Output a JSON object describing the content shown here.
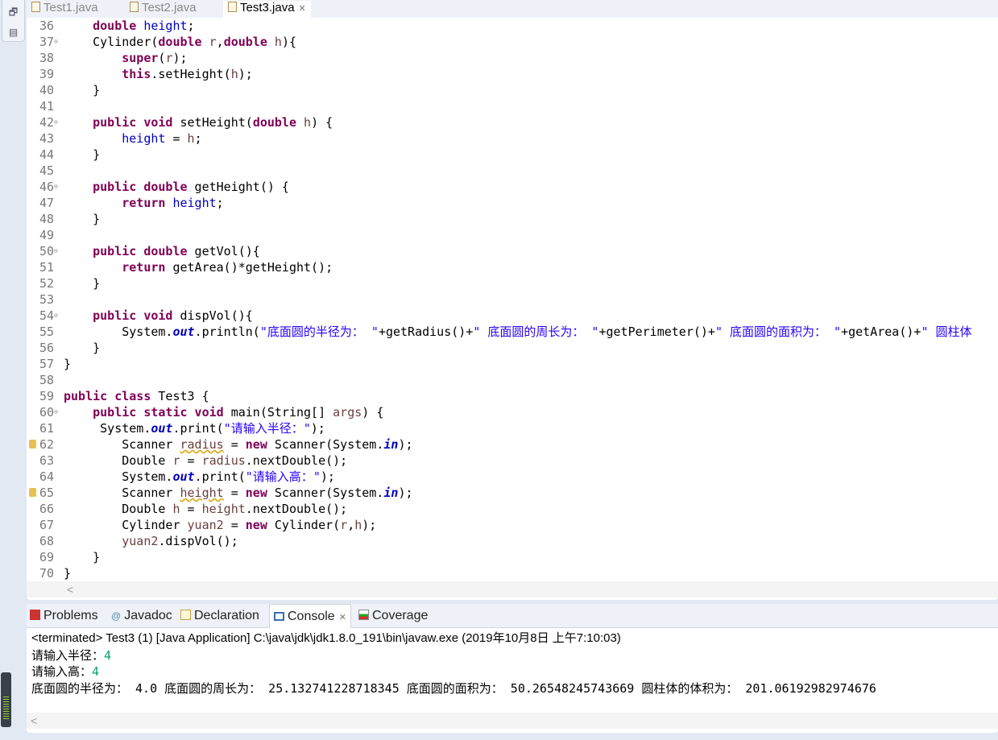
{
  "editor": {
    "tabs": [
      {
        "label": "Test1.java"
      },
      {
        "label": "Test2.java"
      },
      {
        "label": "Test3.java",
        "active": true
      }
    ],
    "close_glyph": "✕",
    "lines": [
      {
        "n": "36",
        "s": [
          [
            "",
            "    "
          ],
          [
            "kw",
            "double"
          ],
          [
            "",
            " "
          ],
          [
            "fld",
            "height"
          ],
          [
            "",
            ";"
          ]
        ]
      },
      {
        "n": "37",
        "fold": true,
        "s": [
          [
            "",
            "    Cylinder("
          ],
          [
            "kw",
            "double"
          ],
          [
            "",
            " "
          ],
          [
            "par",
            "r"
          ],
          [
            "",
            ","
          ],
          [
            "kw",
            "double"
          ],
          [
            "",
            " "
          ],
          [
            "par",
            "h"
          ],
          [
            "",
            "){"
          ]
        ]
      },
      {
        "n": "38",
        "s": [
          [
            "",
            "        "
          ],
          [
            "kw",
            "super"
          ],
          [
            "",
            "("
          ],
          [
            "par",
            "r"
          ],
          [
            "",
            ");"
          ]
        ]
      },
      {
        "n": "39",
        "s": [
          [
            "",
            "        "
          ],
          [
            "kw",
            "this"
          ],
          [
            "",
            ".setHeight("
          ],
          [
            "par",
            "h"
          ],
          [
            "",
            ");"
          ]
        ]
      },
      {
        "n": "40",
        "s": [
          [
            "",
            "    }"
          ]
        ]
      },
      {
        "n": "41",
        "s": []
      },
      {
        "n": "42",
        "fold": true,
        "s": [
          [
            "",
            "    "
          ],
          [
            "kw",
            "public void"
          ],
          [
            "",
            " setHeight("
          ],
          [
            "kw",
            "double"
          ],
          [
            "",
            " "
          ],
          [
            "par",
            "h"
          ],
          [
            "",
            ") {"
          ]
        ]
      },
      {
        "n": "43",
        "s": [
          [
            "",
            "        "
          ],
          [
            "fld",
            "height"
          ],
          [
            "",
            " = "
          ],
          [
            "par",
            "h"
          ],
          [
            "",
            ";"
          ]
        ]
      },
      {
        "n": "44",
        "s": [
          [
            "",
            "    }"
          ]
        ]
      },
      {
        "n": "45",
        "s": []
      },
      {
        "n": "46",
        "fold": true,
        "s": [
          [
            "",
            "    "
          ],
          [
            "kw",
            "public double"
          ],
          [
            "",
            " getHeight() {"
          ]
        ]
      },
      {
        "n": "47",
        "s": [
          [
            "",
            "        "
          ],
          [
            "kw",
            "return"
          ],
          [
            "",
            " "
          ],
          [
            "fld",
            "height"
          ],
          [
            "",
            ";"
          ]
        ]
      },
      {
        "n": "48",
        "s": [
          [
            "",
            "    }"
          ]
        ]
      },
      {
        "n": "49",
        "s": []
      },
      {
        "n": "50",
        "fold": true,
        "s": [
          [
            "",
            "    "
          ],
          [
            "kw",
            "public double"
          ],
          [
            "",
            " getVol(){"
          ]
        ]
      },
      {
        "n": "51",
        "s": [
          [
            "",
            "        "
          ],
          [
            "kw",
            "return"
          ],
          [
            "",
            " getArea()*getHeight();"
          ]
        ]
      },
      {
        "n": "52",
        "s": [
          [
            "",
            "    }"
          ]
        ]
      },
      {
        "n": "53",
        "s": []
      },
      {
        "n": "54",
        "fold": true,
        "s": [
          [
            "",
            "    "
          ],
          [
            "kw",
            "public void"
          ],
          [
            "",
            " dispVol(){"
          ]
        ]
      },
      {
        "n": "55",
        "s": [
          [
            "",
            "        System."
          ],
          [
            "fldi",
            "out"
          ],
          [
            "",
            ".println("
          ],
          [
            "str",
            "\"底面圆的半径为： \""
          ],
          [
            "",
            "+getRadius()+"
          ],
          [
            "str",
            "\" 底面圆的周长为： \""
          ],
          [
            "",
            "+getPerimeter()+"
          ],
          [
            "str",
            "\" 底面圆的面积为： \""
          ],
          [
            "",
            "+getArea()+"
          ],
          [
            "str",
            "\" 圆柱体"
          ]
        ]
      },
      {
        "n": "56",
        "s": [
          [
            "",
            "    }"
          ]
        ]
      },
      {
        "n": "57",
        "s": [
          [
            "",
            "}"
          ]
        ]
      },
      {
        "n": "58",
        "s": []
      },
      {
        "n": "59",
        "s": [
          [
            "kw",
            "public class"
          ],
          [
            "",
            " Test3 {"
          ]
        ]
      },
      {
        "n": "60",
        "fold": true,
        "s": [
          [
            "",
            "    "
          ],
          [
            "kw",
            "public static void"
          ],
          [
            "",
            " main(String[] "
          ],
          [
            "par",
            "args"
          ],
          [
            "",
            ") {"
          ]
        ]
      },
      {
        "n": "61",
        "s": [
          [
            "",
            "     System."
          ],
          [
            "fldi",
            "out"
          ],
          [
            "",
            ".print("
          ],
          [
            "str",
            "\"请输入半径：\""
          ],
          [
            "",
            ");"
          ]
        ]
      },
      {
        "n": "62",
        "warn": true,
        "s": [
          [
            "",
            "        Scanner "
          ],
          [
            "par wv",
            "radius"
          ],
          [
            "",
            " = "
          ],
          [
            "kw",
            "new"
          ],
          [
            "",
            " Scanner(System."
          ],
          [
            "fldi",
            "in"
          ],
          [
            "",
            ");"
          ]
        ]
      },
      {
        "n": "63",
        "s": [
          [
            "",
            "        Double "
          ],
          [
            "par",
            "r"
          ],
          [
            "",
            " = "
          ],
          [
            "par",
            "radius"
          ],
          [
            "",
            ".nextDouble();"
          ]
        ]
      },
      {
        "n": "64",
        "s": [
          [
            "",
            "        System."
          ],
          [
            "fldi",
            "out"
          ],
          [
            "",
            ".print("
          ],
          [
            "str",
            "\"请输入高：\""
          ],
          [
            "",
            ");"
          ]
        ]
      },
      {
        "n": "65",
        "warn": true,
        "s": [
          [
            "",
            "        Scanner "
          ],
          [
            "par wv",
            "height"
          ],
          [
            "",
            " = "
          ],
          [
            "kw",
            "new"
          ],
          [
            "",
            " Scanner(System."
          ],
          [
            "fldi",
            "in"
          ],
          [
            "",
            ");"
          ]
        ]
      },
      {
        "n": "66",
        "s": [
          [
            "",
            "        Double "
          ],
          [
            "par",
            "h"
          ],
          [
            "",
            " = "
          ],
          [
            "par",
            "height"
          ],
          [
            "",
            ".nextDouble();"
          ]
        ]
      },
      {
        "n": "67",
        "s": [
          [
            "",
            "        Cylinder "
          ],
          [
            "par",
            "yuan2"
          ],
          [
            "",
            " = "
          ],
          [
            "kw",
            "new"
          ],
          [
            "",
            " Cylinder("
          ],
          [
            "par",
            "r"
          ],
          [
            "",
            ","
          ],
          [
            "par",
            "h"
          ],
          [
            "",
            ");"
          ]
        ]
      },
      {
        "n": "68",
        "s": [
          [
            "",
            "        "
          ],
          [
            "par",
            "yuan2"
          ],
          [
            "",
            ".dispVol();"
          ]
        ]
      },
      {
        "n": "69",
        "s": [
          [
            "",
            "    }"
          ]
        ]
      },
      {
        "n": "70",
        "s": [
          [
            "",
            "}"
          ]
        ]
      }
    ]
  },
  "panel": {
    "tabs": [
      {
        "label": "Problems",
        "icon": "problems-icon"
      },
      {
        "label": "Javadoc",
        "icon": "at-icon"
      },
      {
        "label": "Declaration",
        "icon": "declaration-icon"
      },
      {
        "label": "Console",
        "icon": "console-icon",
        "active": true
      },
      {
        "label": "Coverage",
        "icon": "coverage-icon"
      }
    ],
    "header": "<terminated> Test3 (1) [Java Application] C:\\java\\jdk\\jdk1.8.0_191\\bin\\javaw.exe (2019年10月8日 上午7:10:03)",
    "output": [
      {
        "prompt": "请输入半径：",
        "input": "4"
      },
      {
        "prompt": "请输入高：",
        "input": "4"
      },
      {
        "prompt": "底面圆的半径为： 4.0 底面圆的周长为： 25.132741228718345 底面圆的面积为： 50.26548245743669 圆柱体的体积为： 201.06192982974676",
        "input": ""
      }
    ]
  },
  "scroll_glyph": "<"
}
